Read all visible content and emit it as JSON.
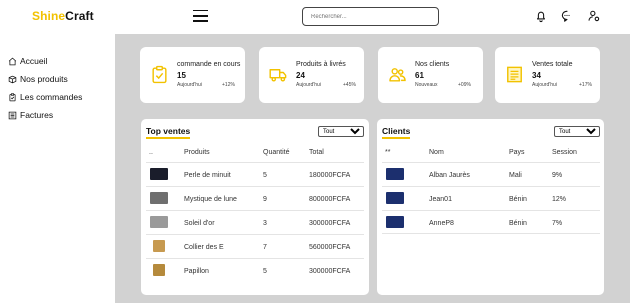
{
  "header": {
    "logo_part1": "Shine",
    "logo_part2": "Craft",
    "search_placeholder": "Rechercher..."
  },
  "icons": {
    "menu": "hamburger-icon",
    "notifications": "bell-icon",
    "messages": "chat-icon",
    "account": "user-settings-icon"
  },
  "sidebar": {
    "items": [
      {
        "label": "Accueil",
        "icon": "home-icon"
      },
      {
        "label": "Nos produits",
        "icon": "box-icon"
      },
      {
        "label": "Les commandes",
        "icon": "clipboard-icon"
      },
      {
        "label": "Factures",
        "icon": "invoice-icon"
      }
    ]
  },
  "colors": {
    "accent": "#f2c200",
    "background": "#d2d2d2"
  },
  "stats": [
    {
      "title": "commande en cours",
      "value": "15",
      "sub": "Aujourd'hui",
      "pct": "+12%",
      "icon": "clipboard-check-icon"
    },
    {
      "title": "Produits à livrés",
      "value": "24",
      "sub": "Aujourd'hui",
      "pct": "+45%",
      "icon": "truck-icon"
    },
    {
      "title": "Nos clients",
      "value": "61",
      "sub": "Nouveaux",
      "pct": "+09%",
      "icon": "users-icon"
    },
    {
      "title": "Ventes totale",
      "value": "34",
      "sub": "Aujourd'hui",
      "pct": "+17%",
      "icon": "receipt-icon"
    }
  ],
  "top_sales": {
    "title": "Top ventes",
    "filter": "Tout",
    "headers": [
      "..",
      "Produits",
      "Quantité",
      "Total"
    ],
    "rows": [
      {
        "product": "Perle de minuit",
        "qty": "5",
        "total": "180000FCFA",
        "thumb": "#1a1d2b"
      },
      {
        "product": "Mystique de lune",
        "qty": "9",
        "total": "800000FCFA",
        "thumb": "#6f6f6f"
      },
      {
        "product": "Soleil d'or",
        "qty": "3",
        "total": "300000FCFA",
        "thumb": "#9a9a9a"
      },
      {
        "product": "Collier des E",
        "qty": "7",
        "total": "560000FCFA",
        "thumb": "#c79a50"
      },
      {
        "product": "Papillon",
        "qty": "5",
        "total": "300000FCFA",
        "thumb": "#b58a3c"
      }
    ]
  },
  "clients": {
    "title": "Clients",
    "filter": "Tout",
    "headers": [
      "**",
      "Nom",
      "Pays",
      "Session"
    ],
    "rows": [
      {
        "name": "Alban Jaurès",
        "country": "Mali",
        "session": "9%"
      },
      {
        "name": "Jean01",
        "country": "Bénin",
        "session": "12%"
      },
      {
        "name": "AnneP8",
        "country": "Bénin",
        "session": "7%"
      }
    ]
  }
}
